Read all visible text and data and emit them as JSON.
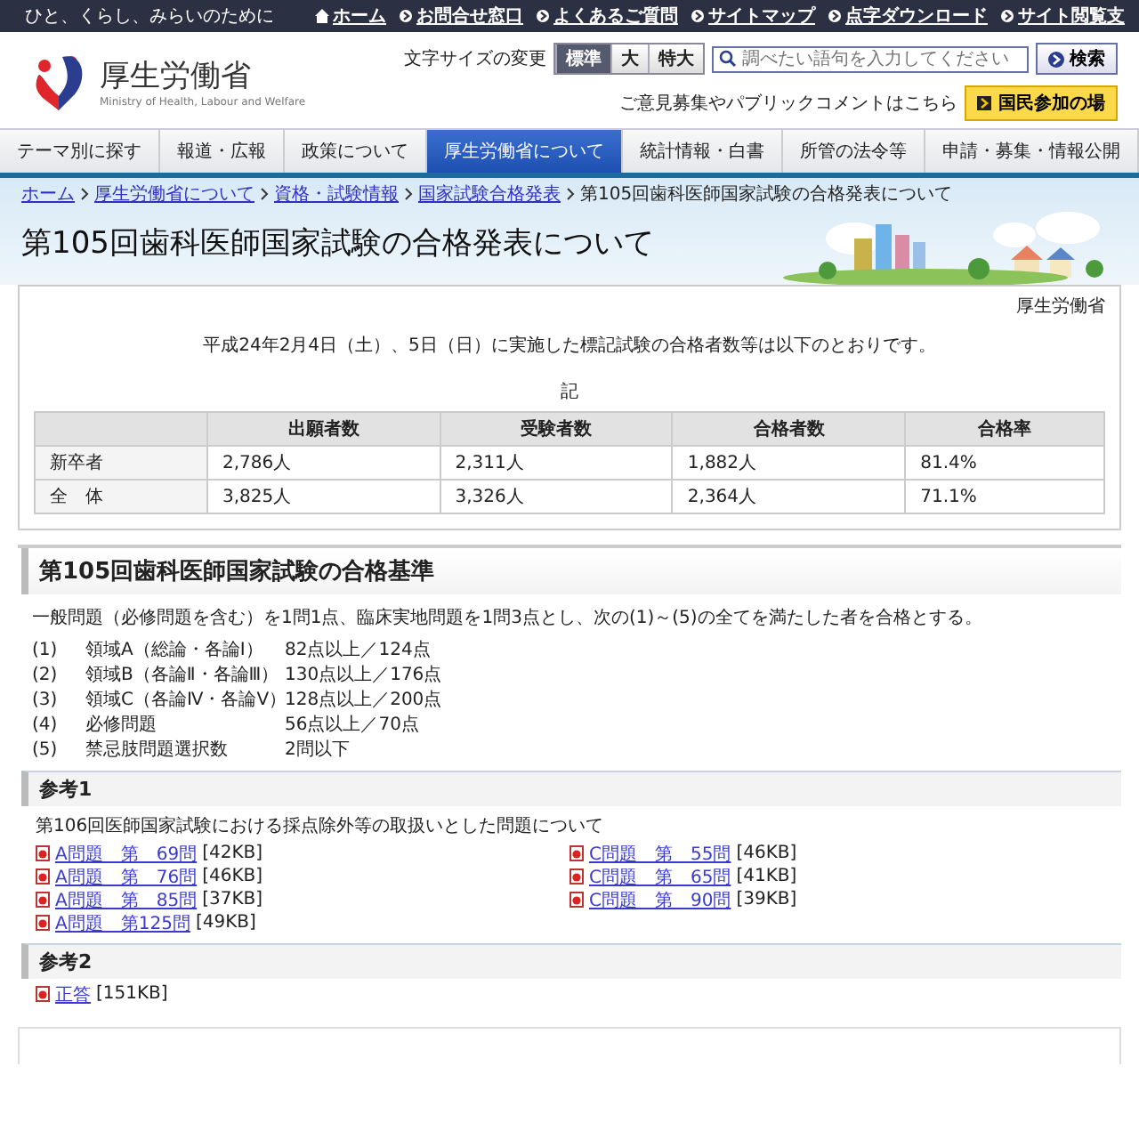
{
  "top_bar": {
    "tagline": "ひと、くらし、みらいのために",
    "links": [
      "ホーム",
      "お問合せ窓口",
      "よくあるご質問",
      "サイトマップ",
      "点字ダウンロード",
      "サイト閲覧支"
    ]
  },
  "header": {
    "logo_text": "厚生労働省",
    "logo_subtitle": "Ministry of Health, Labour and Welfare",
    "font_size_label": "文字サイズの変更",
    "font_sizes": [
      {
        "label": "標準",
        "selected": true
      },
      {
        "label": "大",
        "selected": false
      },
      {
        "label": "特大",
        "selected": false
      }
    ],
    "search": {
      "placeholder": "調べたい語句を入力してください",
      "button": "検索"
    },
    "comment_text": "ご意見募集やパブリックコメントはこちら",
    "participation_button": "国民参加の場"
  },
  "nav": [
    {
      "label": "テーマ別に探す",
      "selected": false
    },
    {
      "label": "報道・広報",
      "selected": false
    },
    {
      "label": "政策について",
      "selected": false
    },
    {
      "label": "厚生労働省について",
      "selected": true
    },
    {
      "label": "統計情報・白書",
      "selected": false
    },
    {
      "label": "所管の法令等",
      "selected": false
    },
    {
      "label": "申請・募集・情報公開",
      "selected": false
    }
  ],
  "breadcrumb": [
    "ホーム",
    "厚生労働省について",
    "資格・試験情報",
    "国家試験合格発表"
  ],
  "breadcrumb_current": "第105回歯科医師国家試験の合格発表について",
  "page_title": "第105回歯科医師国家試験の合格発表について",
  "author": "厚生労働省",
  "intro": "平成24年2月4日（土）、5日（日）に実施した標記試験の合格者数等は以下のとおりです。",
  "note_label": "記",
  "table": {
    "columns": [
      "出願者数",
      "受験者数",
      "合格者数",
      "合格率"
    ],
    "rows": [
      {
        "label": "新卒者",
        "cells": [
          "2,786人",
          "2,311人",
          "1,882人",
          "81.4%"
        ]
      },
      {
        "label": "全　体",
        "cells": [
          "3,825人",
          "3,326人",
          "2,364人",
          "71.1%"
        ]
      }
    ]
  },
  "criteria": {
    "title": "第105回歯科医師国家試験の合格基準",
    "description": "一般問題（必修問題を含む）を1問1点、臨床実地問題を1問3点とし、次の(1)～(5)の全てを満たした者を合格とする。",
    "items": [
      {
        "number": "(1)",
        "field": "領域A（総論・各論Ⅰ）",
        "score": "82点以上／124点"
      },
      {
        "number": "(2)",
        "field": "領域B（各論Ⅱ・各論Ⅲ）",
        "score": "130点以上／176点"
      },
      {
        "number": "(3)",
        "field": "領域C（各論Ⅳ・各論Ⅴ）",
        "score": "128点以上／200点"
      },
      {
        "number": "(4)",
        "field": "必修問題",
        "score": "56点以上／70点"
      },
      {
        "number": "(5)",
        "field": "禁忌肢問題選択数",
        "score": "2問以下"
      }
    ]
  },
  "references": [
    {
      "title": "参考1",
      "text": "第106回医師国家試験における採点除外等の取扱いとした問題について",
      "link_columns": [
        [
          {
            "label": "A問題　第　69問",
            "size": "[42KB]"
          },
          {
            "label": "A問題　第　76問",
            "size": "[46KB]"
          },
          {
            "label": "A問題　第　85問",
            "size": "[37KB]"
          },
          {
            "label": "A問題　第125問",
            "size": "[49KB]"
          }
        ],
        [
          {
            "label": "C問題　第　55問",
            "size": "[46KB]"
          },
          {
            "label": "C問題　第　65問",
            "size": "[41KB]"
          },
          {
            "label": "C問題　第　90問",
            "size": "[39KB]"
          }
        ]
      ]
    },
    {
      "title": "参考2",
      "link_columns": [
        [
          {
            "label": "正答",
            "size": "[151KB]"
          }
        ]
      ]
    }
  ]
}
